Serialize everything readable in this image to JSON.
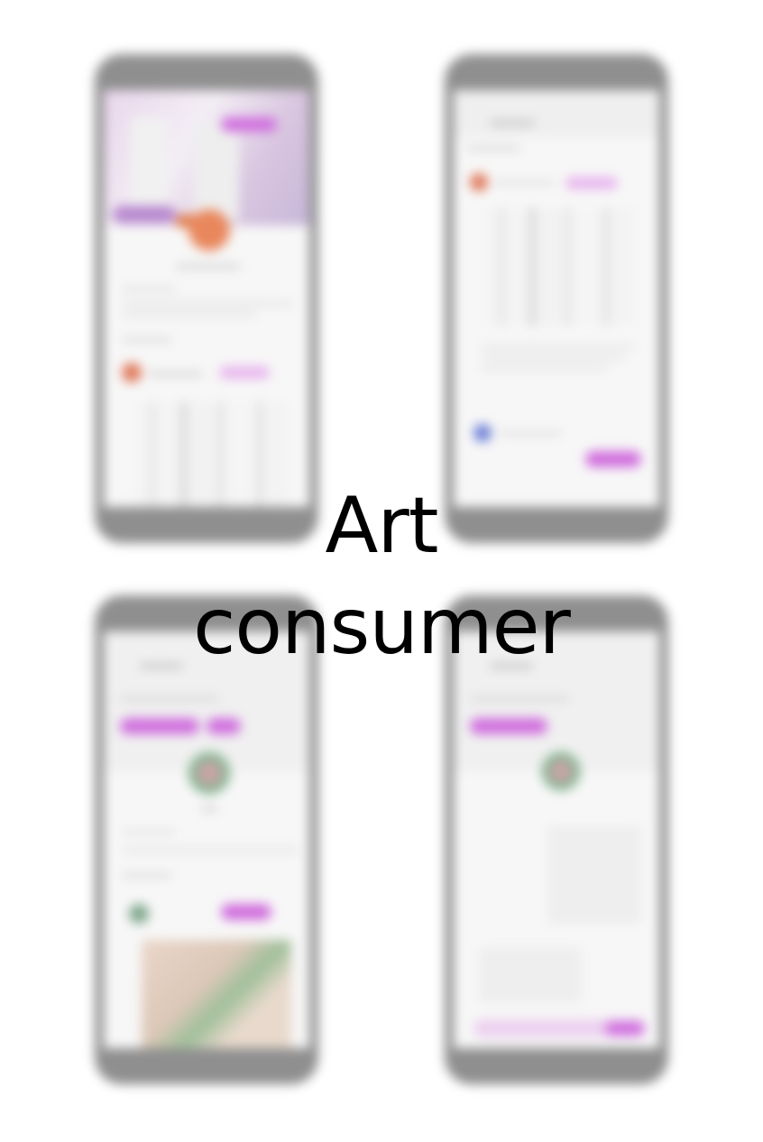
{
  "title": {
    "line1": "Art",
    "line2": "consumer"
  },
  "colors": {
    "accent": "#d06fde",
    "accent_light": "#e8b6ee",
    "phone_frame": "#8f8f8f",
    "background": "#ffffff"
  },
  "mockups": [
    {
      "name": "profile-screen"
    },
    {
      "name": "feed-screen"
    },
    {
      "name": "artist-profile-screen"
    },
    {
      "name": "chat-screen"
    }
  ]
}
